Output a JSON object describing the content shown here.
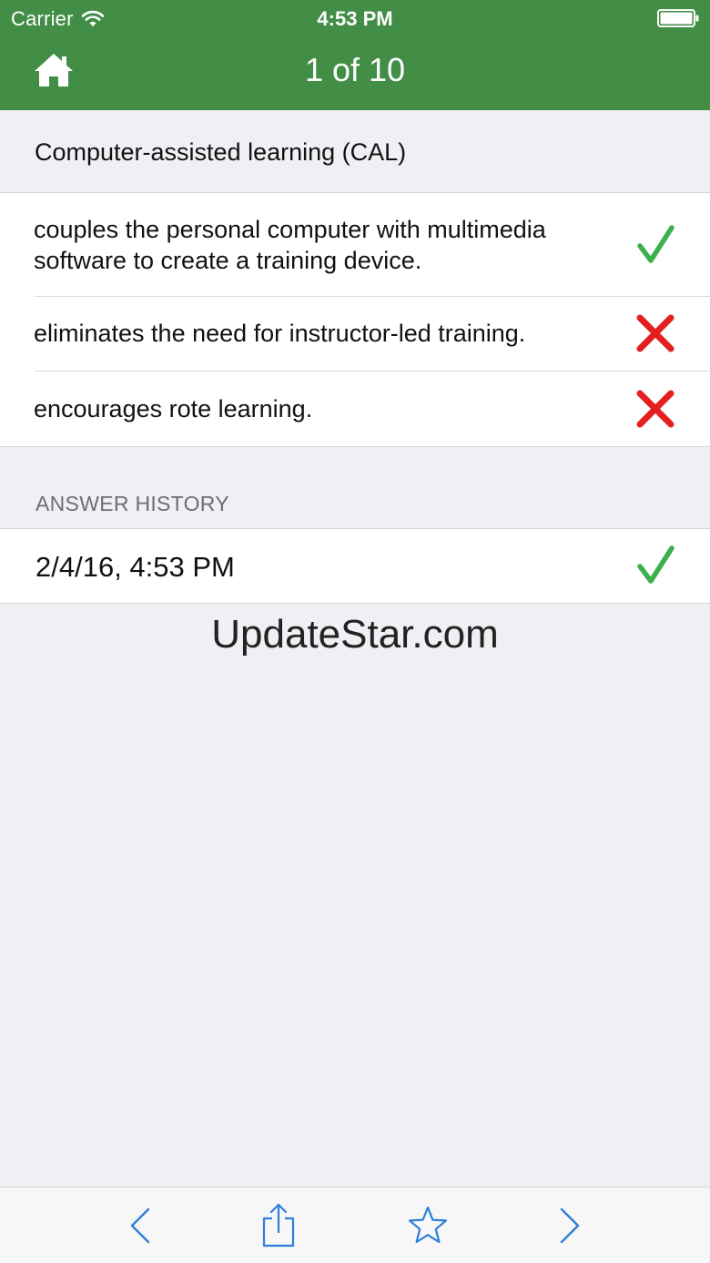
{
  "status_bar": {
    "carrier": "Carrier",
    "time": "4:53 PM",
    "wifi_icon": "wifi-icon",
    "battery_icon": "battery-icon"
  },
  "nav": {
    "title": "1 of 10",
    "home_icon": "home-icon",
    "background_color": "#438e46"
  },
  "question": {
    "text": "Computer-assisted learning (CAL)"
  },
  "answers": [
    {
      "text": "couples the personal computer with multimedia software to create a training device.",
      "result": "correct"
    },
    {
      "text": "eliminates the need for instructor-led training.",
      "result": "incorrect"
    },
    {
      "text": "encourages rote learning.",
      "result": "incorrect"
    }
  ],
  "history": {
    "header": "ANSWER HISTORY",
    "entries": [
      {
        "date": "2/4/16, 4:53 PM",
        "result": "correct"
      }
    ]
  },
  "watermark": "UpdateStar.com",
  "toolbar": {
    "items": [
      "back-chevron-icon",
      "share-icon",
      "star-icon",
      "forward-chevron-icon"
    ],
    "tint_color": "#2f7fd6"
  },
  "colors": {
    "correct": "#3cb04a",
    "incorrect": "#e41f1f"
  }
}
